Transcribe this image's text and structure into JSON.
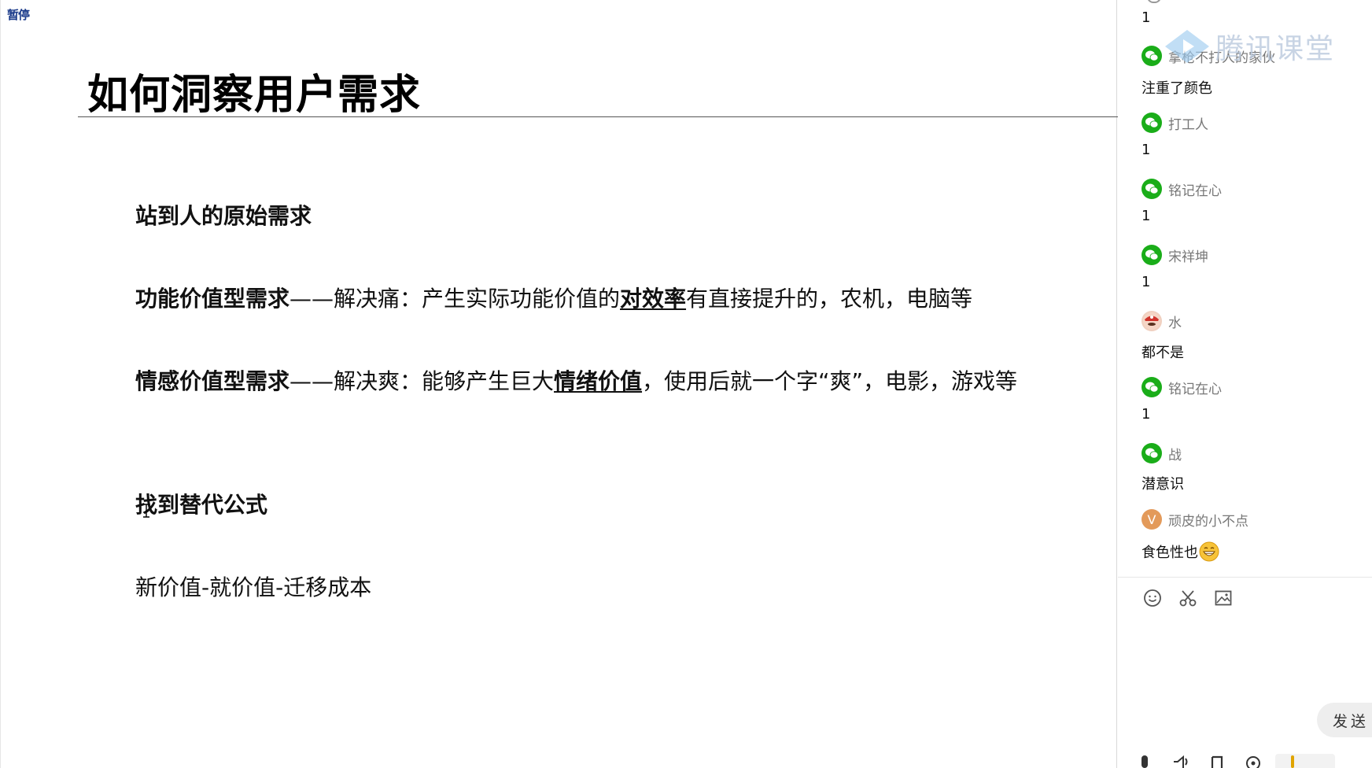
{
  "overlay": {
    "pause_label": "暂停"
  },
  "slide": {
    "title": "如何洞察用户需求",
    "section1_heading": "站到人的原始需求",
    "functional": {
      "label": "功能价值型需求",
      "dash": "——",
      "text1": "解决痛：产生实际功能价值的",
      "emph": "对效率",
      "text2": "有直接提升的，农机，电脑等"
    },
    "emotional": {
      "label": "情感价值型需求",
      "dash": "——",
      "text1": "解决爽：能够产生巨大",
      "emph": "情绪价值",
      "text2": "，使用后就一个字“爽”，电影，游戏等"
    },
    "section2_heading": "找到替代公式",
    "formula": "新价值-就价值-迁移成本"
  },
  "chat": {
    "watermark": "腾讯课堂",
    "messages": [
      {
        "text": "1"
      },
      {
        "sender": "拿枪不打人的家伙",
        "avatar": "wechat",
        "text": "注重了颜色"
      },
      {
        "sender": "打工人",
        "avatar": "wechat",
        "text": "1"
      },
      {
        "sender": "铭记在心",
        "avatar": "wechat",
        "text": "1"
      },
      {
        "sender": "宋祥坤",
        "avatar": "wechat",
        "text": "1"
      },
      {
        "sender": "水",
        "avatar": "mario",
        "text": "都不是"
      },
      {
        "sender": "铭记在心",
        "avatar": "wechat",
        "text": "1"
      },
      {
        "sender": "战",
        "avatar": "wechat",
        "text": "潜意识"
      },
      {
        "sender": "顽皮的小不点",
        "avatar": "v",
        "avatar_letter": "V",
        "text": "食色性也"
      }
    ],
    "toolbar": [
      "emoji-icon",
      "scissors-icon",
      "image-icon"
    ],
    "send_label": "发送",
    "bottom_bar": [
      "mic-icon",
      "speaker-icon",
      "bookmark-icon",
      "location-icon",
      "hand-icon"
    ]
  },
  "colors": {
    "wechat_green": "#1aad19",
    "v_avatar": "#e39a5a"
  }
}
